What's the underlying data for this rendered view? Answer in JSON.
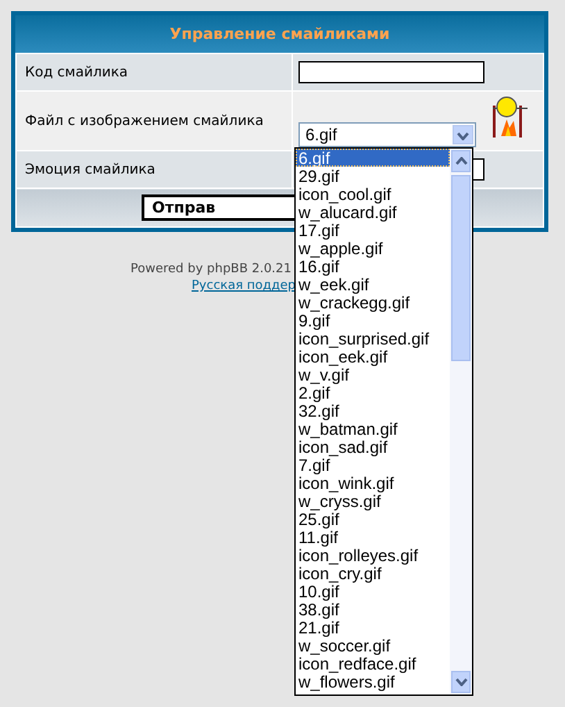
{
  "panel": {
    "title": "Управление смайликами",
    "rows": [
      {
        "label": "Код смайлика",
        "kind": "text"
      },
      {
        "label": "Файл с изображением смайлика",
        "kind": "select",
        "value": "6.gif"
      },
      {
        "label": "Эмоция смайлика",
        "kind": "text"
      }
    ],
    "submit": "Отправ"
  },
  "dropdown": {
    "options": [
      {
        "label": "6.gif",
        "selected": true
      },
      {
        "label": "29.gif",
        "selected": false
      },
      {
        "label": "icon_cool.gif",
        "selected": false
      },
      {
        "label": "w_alucard.gif",
        "selected": false
      },
      {
        "label": "17.gif",
        "selected": false
      },
      {
        "label": "w_apple.gif",
        "selected": false
      },
      {
        "label": "16.gif",
        "selected": false
      },
      {
        "label": "w_eek.gif",
        "selected": false
      },
      {
        "label": "w_crackegg.gif",
        "selected": false
      },
      {
        "label": "9.gif",
        "selected": false
      },
      {
        "label": "icon_surprised.gif",
        "selected": false
      },
      {
        "label": "icon_eek.gif",
        "selected": false
      },
      {
        "label": "w_v.gif",
        "selected": false
      },
      {
        "label": "2.gif",
        "selected": false
      },
      {
        "label": "32.gif",
        "selected": false
      },
      {
        "label": "w_batman.gif",
        "selected": false
      },
      {
        "label": "icon_sad.gif",
        "selected": false
      },
      {
        "label": "7.gif",
        "selected": false
      },
      {
        "label": "icon_wink.gif",
        "selected": false
      },
      {
        "label": "w_cryss.gif",
        "selected": false
      },
      {
        "label": "25.gif",
        "selected": false
      },
      {
        "label": "11.gif",
        "selected": false
      },
      {
        "label": "icon_rolleyes.gif",
        "selected": false
      },
      {
        "label": "icon_cry.gif",
        "selected": false
      },
      {
        "label": "10.gif",
        "selected": false
      },
      {
        "label": "38.gif",
        "selected": false
      },
      {
        "label": "21.gif",
        "selected": false
      },
      {
        "label": "w_soccer.gif",
        "selected": false
      },
      {
        "label": "icon_redface.gif",
        "selected": false
      },
      {
        "label": "w_flowers.gif",
        "selected": false
      }
    ]
  },
  "footer": {
    "text": "Powered by phpBB 2.0.21",
    "link": "Русская поддер"
  }
}
